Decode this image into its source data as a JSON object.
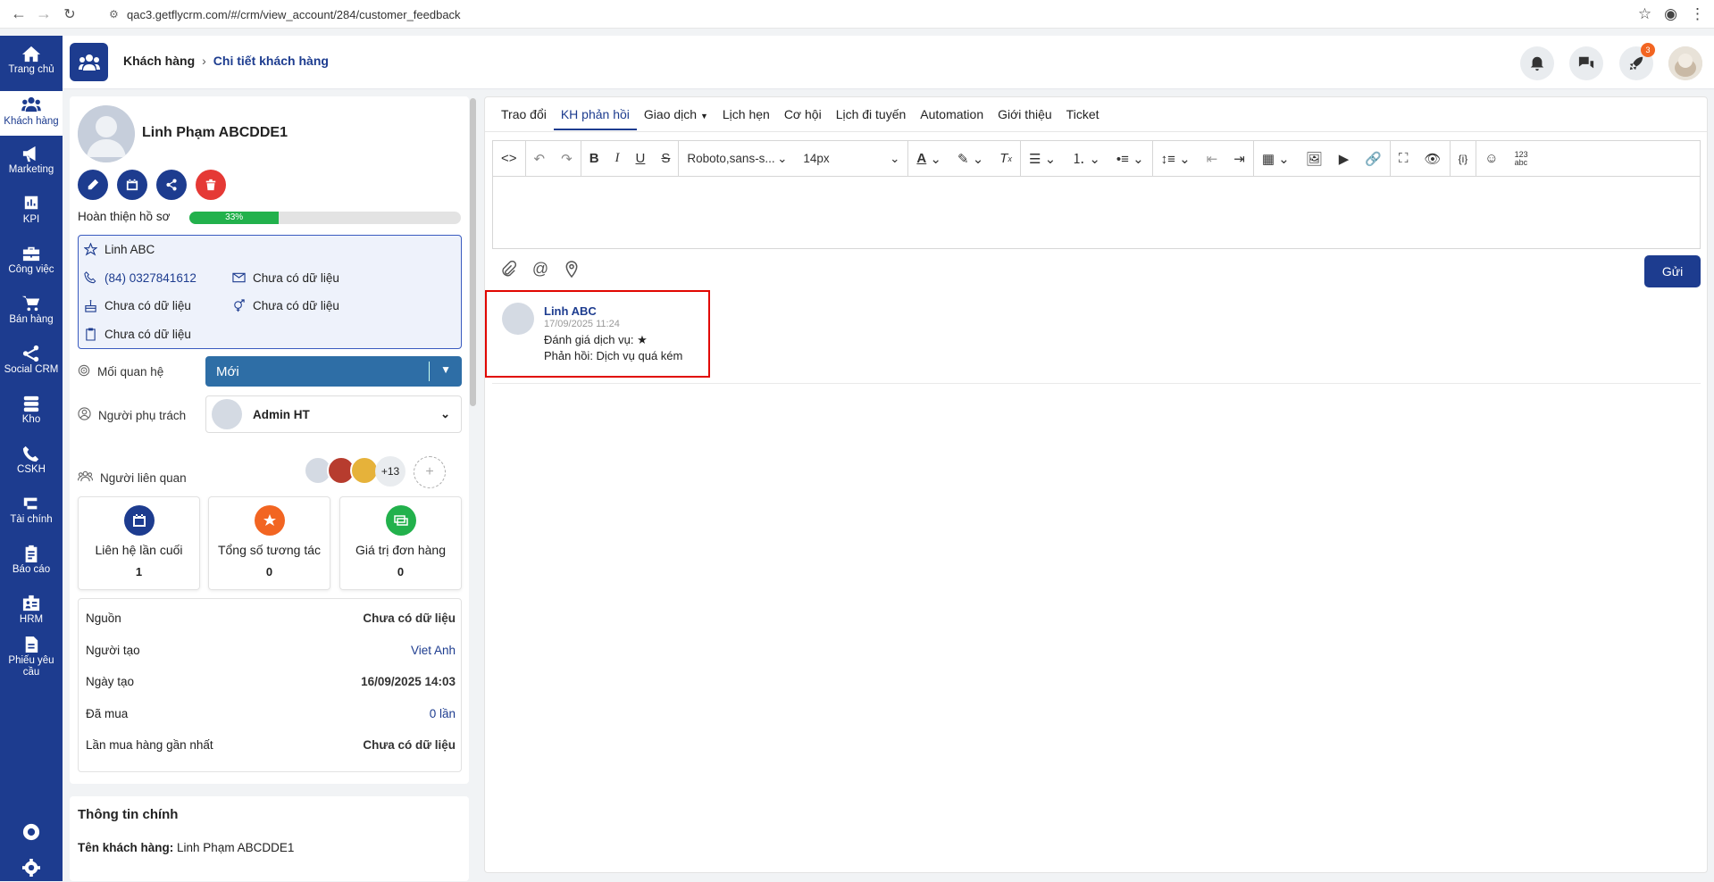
{
  "browser": {
    "url": "qac3.getflycrm.com/#/crm/view_account/284/customer_feedback"
  },
  "sidebar": {
    "items": [
      {
        "label": "Trang chủ",
        "icon": "home-icon"
      },
      {
        "label": "Khách hàng",
        "icon": "users-icon"
      },
      {
        "label": "Marketing",
        "icon": "megaphone-icon"
      },
      {
        "label": "KPI",
        "icon": "chart-icon"
      },
      {
        "label": "Công việc",
        "icon": "briefcase-icon"
      },
      {
        "label": "Bán hàng",
        "icon": "cart-icon"
      },
      {
        "label": "Social CRM",
        "icon": "share-icon"
      },
      {
        "label": "Kho",
        "icon": "stack-icon"
      },
      {
        "label": "CSKH",
        "icon": "phone-icon"
      },
      {
        "label": "Tài chính",
        "icon": "money-icon"
      },
      {
        "label": "Báo cáo",
        "icon": "clipboard-icon"
      },
      {
        "label": "HRM",
        "icon": "id-card-icon"
      },
      {
        "label": "Phiếu yêu cầu",
        "icon": "document-icon"
      }
    ]
  },
  "header": {
    "breadcrumb_1": "Khách hàng",
    "breadcrumb_2": "Chi tiết khách hàng",
    "notification_badge": "3"
  },
  "customer": {
    "name": "Linh Phạm ABCDDE1",
    "progress_label": "Hoàn thiện hồ sơ",
    "progress_value": 33,
    "progress_text": "33%",
    "contact_name": "Linh ABC",
    "phone": "(84) 0327841612",
    "email": "Chưa có dữ liệu",
    "birthday": "Chưa có dữ liệu",
    "gender": "Chưa có dữ liệu",
    "note": "Chưa có dữ liệu",
    "relation_label": "Mối quan hệ",
    "relation_value": "Mới",
    "owner_label": "Người phụ trách",
    "owner_value": "Admin HT",
    "related_label": "Người liên quan",
    "related_more": "+13"
  },
  "stats": [
    {
      "label": "Liên hệ lần cuối",
      "value": "1",
      "color": "#1d3c8f"
    },
    {
      "label": "Tổng số tương tác",
      "value": "0",
      "color": "#f26522"
    },
    {
      "label": "Giá trị đơn hàng",
      "value": "0",
      "color": "#22b14c"
    }
  ],
  "details": [
    {
      "label": "Nguồn",
      "value": "Chưa có dữ liệu"
    },
    {
      "label": "Người tạo",
      "value": "Viet Anh"
    },
    {
      "label": "Ngày tạo",
      "value": "16/09/2025 14:03"
    },
    {
      "label": "Đã mua",
      "value": "0 lần"
    },
    {
      "label": "Lần mua hàng gần nhất",
      "value": "Chưa có dữ liệu"
    }
  ],
  "main_info": {
    "title": "Thông tin chính",
    "name_label": "Tên khách hàng:",
    "name_value": "Linh Phạm ABCDDE1"
  },
  "tabs": [
    "Trao đổi",
    "KH phản hồi",
    "Giao dịch",
    "Lịch hẹn",
    "Cơ hội",
    "Lịch đi tuyến",
    "Automation",
    "Giới thiệu",
    "Ticket"
  ],
  "editor": {
    "font_family": "Roboto,sans-s...",
    "font_size": "14px",
    "send_label": "Gửi"
  },
  "feedback": {
    "author": "Linh ABC",
    "time": "17/09/2025 11:24",
    "rating_line": "Đánh giá dịch vụ: ★",
    "comment_line": "Phản hồi: Dịch vụ quá kém"
  },
  "colors": {
    "brand": "#1d3c8f",
    "progress": "#22b14c",
    "highlight_border": "#e10600"
  }
}
